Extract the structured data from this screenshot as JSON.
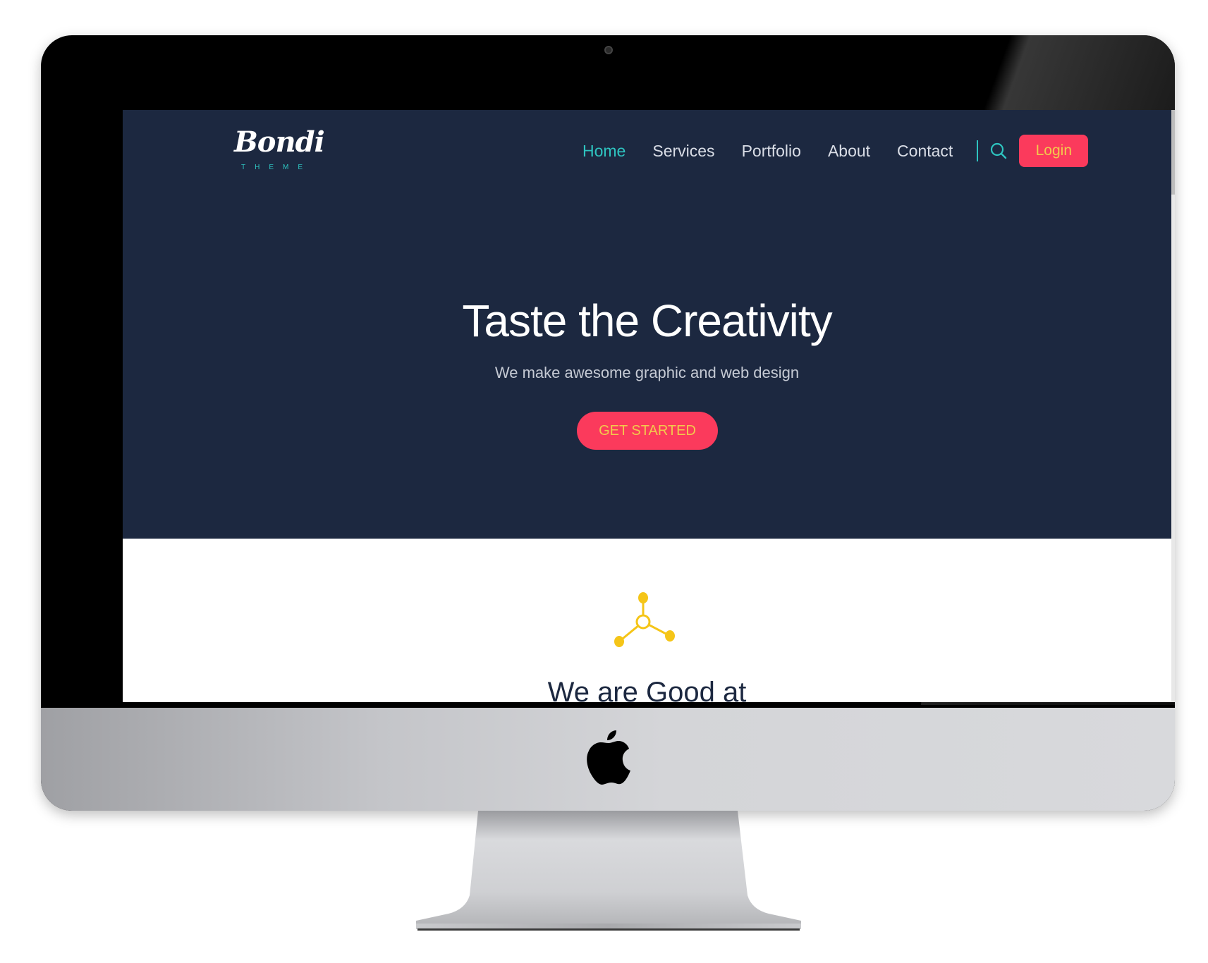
{
  "brand": {
    "name": "Bondi",
    "tagline": "THEME"
  },
  "nav": {
    "items": [
      {
        "label": "Home",
        "active": true
      },
      {
        "label": "Services",
        "active": false
      },
      {
        "label": "Portfolio",
        "active": false
      },
      {
        "label": "About",
        "active": false
      },
      {
        "label": "Contact",
        "active": false
      }
    ],
    "login_label": "Login"
  },
  "hero": {
    "title": "Taste the Creativity",
    "subtitle": "We make awesome graphic and web design",
    "cta_label": "GET STARTED"
  },
  "section": {
    "title": "We are Good at"
  },
  "icons": {
    "search": "search-icon",
    "feature": "molecule-icon",
    "device": "apple-logo"
  },
  "colors": {
    "hero_bg": "#1c2840",
    "accent_teal": "#2ec4c0",
    "accent_red": "#fb3a5c",
    "button_text": "#f2c94c",
    "icon_yellow": "#f5c518"
  }
}
